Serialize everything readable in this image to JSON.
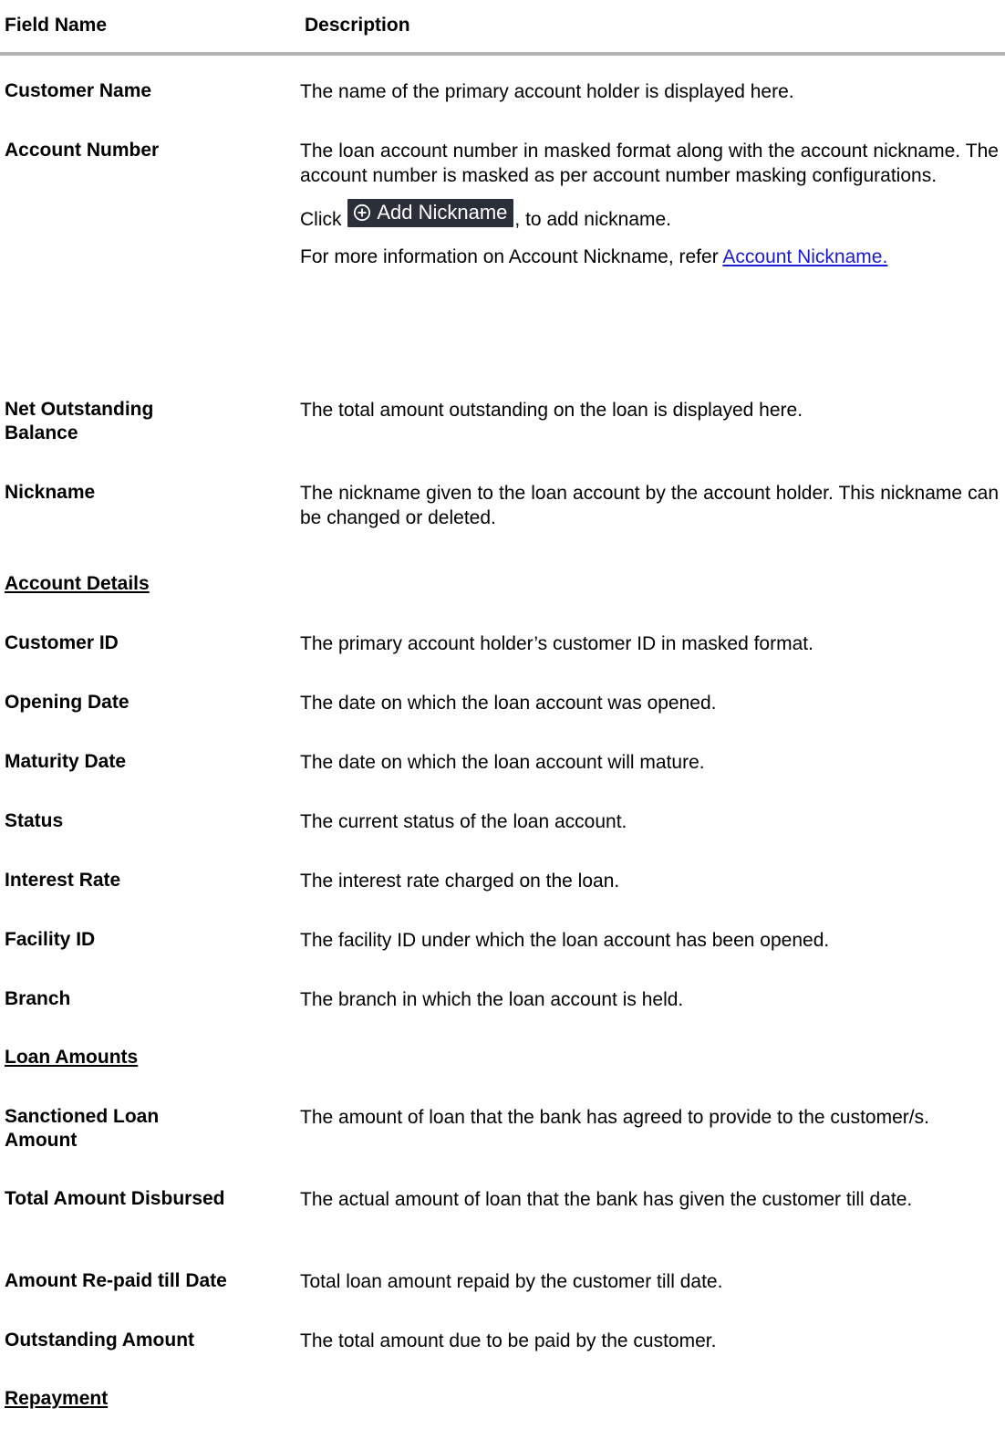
{
  "header": {
    "field_name": "Field Name",
    "description": "Description"
  },
  "rows": [
    {
      "field": "Customer Name",
      "desc": "The name of the primary account holder is displayed here."
    },
    {
      "field": "Account Number",
      "desc": "The loan account number in masked format along with the account nickname. The account number is masked as per account number masking configurations.",
      "click_prefix": "Click",
      "button_label": "Add Nickname",
      "click_suffix": ", to add nickname.",
      "more_info": "For more information on Account Nickname, refer",
      "link_text": "Account Nickname",
      "link_period": "."
    },
    {
      "field": "Net Outstanding Balance",
      "desc": "The total amount outstanding on the loan is displayed here."
    },
    {
      "field": "Nickname",
      "desc": "The nickname given to the loan account by the account holder. This nickname can be changed or deleted."
    },
    {
      "field": "Customer ID",
      "desc": "The primary account holder’s customer ID in masked format."
    },
    {
      "field": "Opening Date",
      "desc": "The date on which the loan account was opened."
    },
    {
      "field": "Maturity Date",
      "desc": "The date on which the loan account will mature."
    },
    {
      "field": "Status",
      "desc": "The current status of the loan account."
    },
    {
      "field": "Interest Rate",
      "desc": "The interest rate charged on the loan."
    },
    {
      "field": "Facility ID",
      "desc": "The facility ID under which the loan account has been opened."
    },
    {
      "field": "Branch",
      "desc": "The branch in which the loan account is held."
    },
    {
      "field": "Sanctioned Loan Amount",
      "desc": "The amount of loan that the bank has agreed to provide to the customer/s."
    },
    {
      "field": "Total Amount Disbursed",
      "desc": "The actual amount of loan that the bank has given the customer till date."
    },
    {
      "field": "Amount Re-paid till Date",
      "desc": "Total loan amount repaid by the customer till date."
    },
    {
      "field": "Outstanding Amount",
      "desc": "The total amount due to be paid by the customer."
    }
  ],
  "sections": {
    "account_details": "Account Details",
    "loan_amounts": "Loan Amounts",
    "repayment": "Repayment"
  },
  "colors": {
    "button_bg": "#2b2f3a",
    "link": "#1a1ad6",
    "header_rule": "#b3b3b3"
  },
  "icons": {
    "add": "plus-circle-icon"
  }
}
